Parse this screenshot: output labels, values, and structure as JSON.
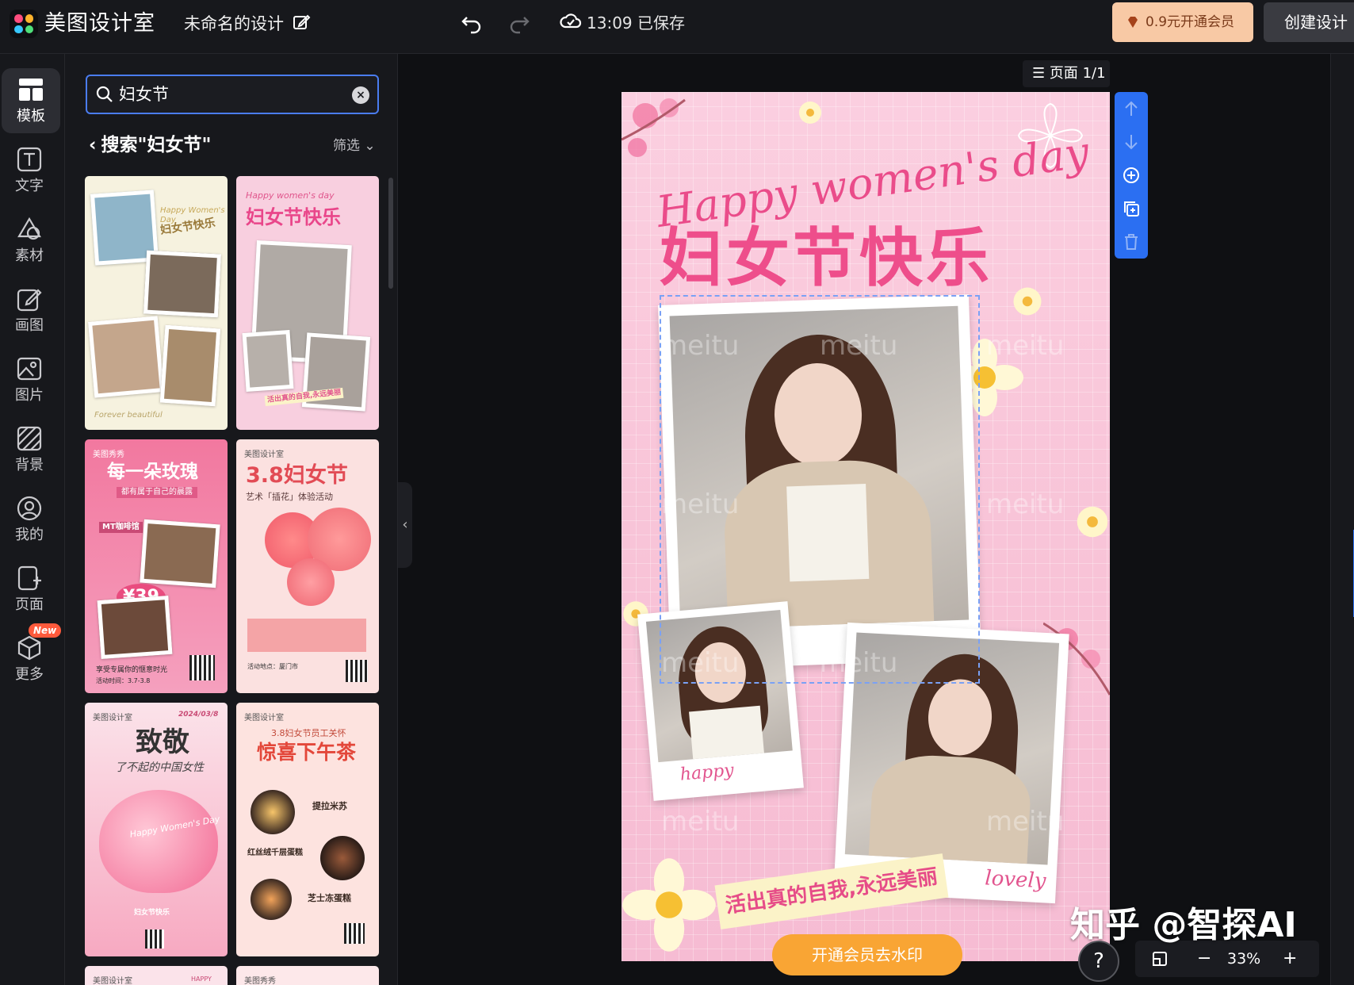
{
  "app": {
    "brand": "美图设计室",
    "doc_title": "未命名的设计",
    "save_time": "13:09 已保存"
  },
  "header": {
    "vip_label": "0.9元开通会员",
    "create_label": "创建设计"
  },
  "sidebar": {
    "items": [
      {
        "label": "模板",
        "icon": "template-icon"
      },
      {
        "label": "文字",
        "icon": "text-icon"
      },
      {
        "label": "素材",
        "icon": "material-icon"
      },
      {
        "label": "画图",
        "icon": "draw-icon"
      },
      {
        "label": "图片",
        "icon": "image-icon"
      },
      {
        "label": "背景",
        "icon": "background-icon"
      },
      {
        "label": "我的",
        "icon": "user-icon"
      },
      {
        "label": "页面",
        "icon": "page-icon"
      },
      {
        "label": "更多",
        "icon": "more-icon"
      }
    ],
    "new_badge": "New"
  },
  "search": {
    "query": "妇女节",
    "result_title": "搜索\"妇女节\"",
    "filter_label": "筛选"
  },
  "templates": [
    {
      "script": "Happy Women's Day",
      "title": "妇女节快乐",
      "footer": "Forever beautiful"
    },
    {
      "script": "Happy women's day",
      "title": "妇女节快乐",
      "caption": "活出真的自我,永远美丽",
      "brand": ""
    },
    {
      "brand": "美图秀秀",
      "title": "每一朵玫瑰",
      "subtitle": "都有属于自己的晨露",
      "tag": "MT咖啡馆",
      "price": "¥39",
      "footer": "享受专属你的惬意时光",
      "date": "活动时间：3.7-3.8"
    },
    {
      "brand": "美图设计室",
      "title": "3.8妇女节",
      "subtitle": "艺术「插花」体验活动",
      "footer": "活动地点：厦门市"
    },
    {
      "brand": "美图设计室",
      "date": "2024/03/8",
      "title": "致敬",
      "subtitle": "了不起的中国女性",
      "script": "Happy Women's Day",
      "footer": "妇女节快乐"
    },
    {
      "brand": "美图设计室",
      "kicker": "3.8妇女节员工关怀",
      "title": "惊喜下午茶",
      "items": [
        "提拉米苏",
        "红丝绒千层蛋糕",
        "芝士冻蛋糕"
      ]
    },
    {
      "brand": "美图设计室",
      "title": "HAPPY"
    },
    {
      "brand": "美图秀秀",
      "title": ""
    }
  ],
  "canvas": {
    "page_indicator": "页面 1/1",
    "poster": {
      "script": "Happy women's day",
      "title": "妇女节快乐",
      "ribbon": "活出真的自我,永远美丽",
      "cap_small": "happy",
      "cap_large": "lovely",
      "watermark": "meitu"
    },
    "remove_watermark": "开通会员去水印",
    "help": "?",
    "zoom": "33%",
    "zoom_minus": "−",
    "zoom_plus": "+"
  },
  "overlay": {
    "credit": "知乎 @智探AI"
  },
  "colors": {
    "accent": "#2b6ff2",
    "vip_bg": "#f8c9a5",
    "poster_pink": "#f8c3d7",
    "title_pink": "#ee4e8b",
    "cta_orange": "#f9a534"
  }
}
